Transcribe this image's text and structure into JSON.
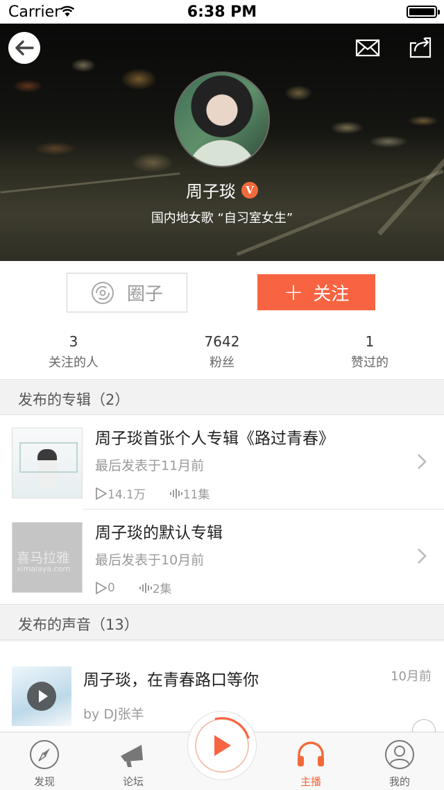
{
  "status_bar": {
    "carrier": "Carrier",
    "time": "6:38 PM"
  },
  "profile": {
    "name": "周子琰",
    "verified_badge": "V",
    "description": "国内地女歌 “自习室女生”"
  },
  "actions": {
    "circle_label": "圈子",
    "follow_plus": "+",
    "follow_label": "关注"
  },
  "stats": [
    {
      "value": "3",
      "label": "关注的人"
    },
    {
      "value": "7642",
      "label": "粉丝"
    },
    {
      "value": "1",
      "label": "赞过的"
    }
  ],
  "albums_section": {
    "title": "发布的专辑（2）"
  },
  "albums": [
    {
      "title": "周子琰首张个人专辑《路过青春》",
      "subtitle": "最后发表于11月前",
      "plays": "14.1万",
      "tracks": "11集"
    },
    {
      "title": "周子琰的默认专辑",
      "subtitle": "最后发表于10月前",
      "plays": "0",
      "tracks": "2集",
      "cover_watermark": "喜马拉雅",
      "cover_watermark_sub": "ximalaya.com"
    }
  ],
  "sounds_section": {
    "title": "发布的声音（13）"
  },
  "sounds": [
    {
      "title": "周子琰，在青春路口等你",
      "date": "10月前",
      "author": "by DJ张羊"
    }
  ],
  "tabbar": {
    "items": [
      {
        "label": "发现",
        "icon": "compass-icon"
      },
      {
        "label": "论坛",
        "icon": "megaphone-icon"
      },
      {
        "label": "主播",
        "icon": "headphones-icon",
        "active": true
      },
      {
        "label": "我的",
        "icon": "user-icon"
      }
    ]
  },
  "colors": {
    "accent": "#f86442",
    "active_tab": "#f26a3b",
    "verified": "#f26a3b"
  }
}
